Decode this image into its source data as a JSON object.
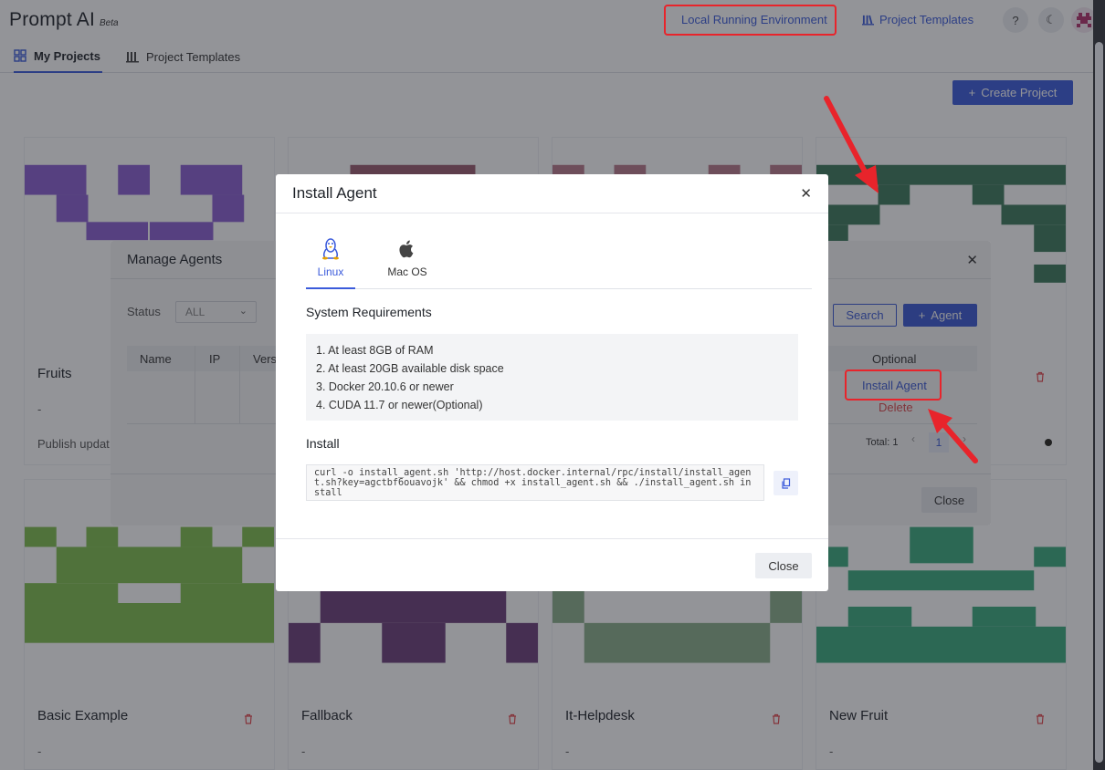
{
  "app": {
    "brand": "Prompt AI",
    "beta": "Beta"
  },
  "header": {
    "env_link": "Local Running Environment",
    "templates_link": "Project Templates",
    "help": "?",
    "theme": "☾"
  },
  "tabs": [
    {
      "label": "My Projects",
      "active": true
    },
    {
      "label": "Project Templates",
      "active": false
    }
  ],
  "create_button": "Create Project",
  "projects": [
    {
      "title": "Fruits",
      "desc": "-",
      "note": "Publish updat",
      "color": "#8a5fd1"
    },
    {
      "title": "",
      "desc": "",
      "color": "#9a5a6e"
    },
    {
      "title": "",
      "desc": "",
      "color": "#b97a8a"
    },
    {
      "title": "",
      "desc": "",
      "color": "#3d7a5a"
    },
    {
      "title": "Basic Example",
      "desc": "-",
      "color": "#7fbf4d"
    },
    {
      "title": "Fallback",
      "desc": "-",
      "color": "#6b3f7a"
    },
    {
      "title": "It-Helpdesk",
      "desc": "-",
      "color": "#8aae8a"
    },
    {
      "title": "New Fruit",
      "desc": "-",
      "color": "#3bab7e"
    }
  ],
  "manage_agents": {
    "title": "Manage Agents",
    "status_label": "Status",
    "status_value": "ALL",
    "search_button": "Search",
    "agent_button": "Agent",
    "columns": [
      "Name",
      "IP",
      "Vers",
      "Optional"
    ],
    "actions": {
      "install": "Install Agent",
      "delete": "Delete"
    },
    "total": "Total: 1",
    "current_page": "1",
    "close": "Close"
  },
  "install_agent": {
    "title": "Install Agent",
    "os_tabs": [
      {
        "label": "Linux",
        "icon": "linux-icon",
        "active": true
      },
      {
        "label": "Mac OS",
        "icon": "apple-icon",
        "active": false
      }
    ],
    "requirements_title": "System Requirements",
    "requirements": [
      "1. At least 8GB of RAM",
      "2. At least 20GB available disk space",
      "3. Docker 20.10.6 or newer",
      "4. CUDA 11.7 or newer(Optional)"
    ],
    "install_title": "Install",
    "command": "curl -o install_agent.sh 'http://host.docker.internal/rpc/install/install_agent.sh?key=agctbf6ouavojk' && chmod +x install_agent.sh && ./install_agent.sh install",
    "close": "Close"
  },
  "colors": {
    "accent": "#3b5bdb",
    "danger": "#e5484d",
    "annotation": "#e8242b"
  }
}
